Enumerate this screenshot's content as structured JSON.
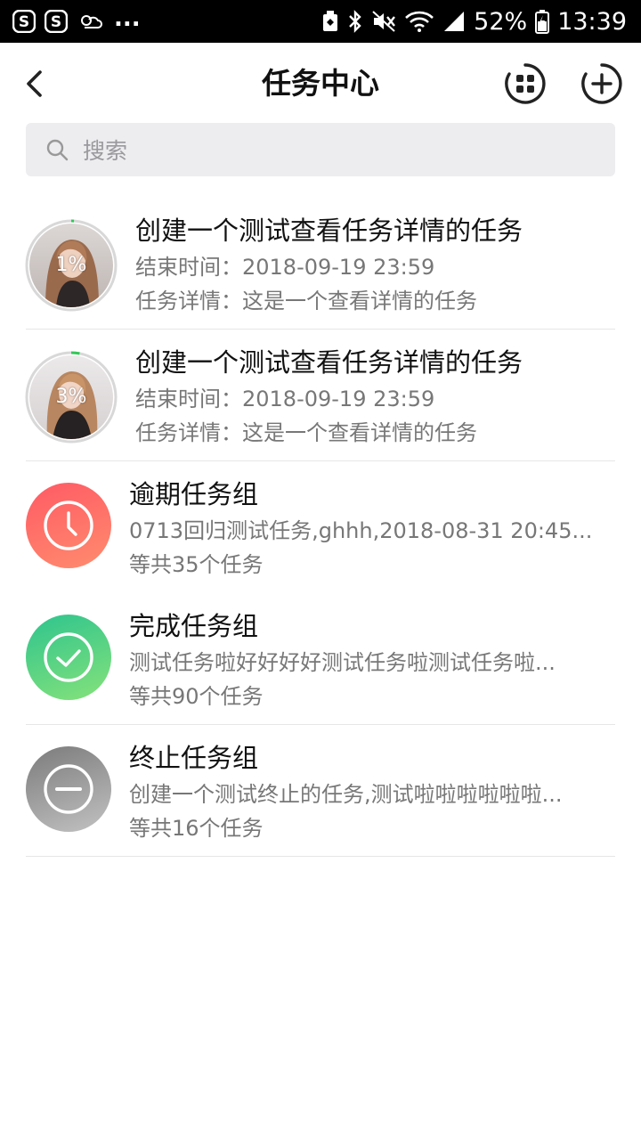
{
  "status_bar": {
    "left_icons": [
      "sogou-s-icon",
      "sogou-s-icon",
      "weather-icon"
    ],
    "overflow": "...",
    "right_icons": [
      "cleanup-icon",
      "bluetooth-icon",
      "mute-icon",
      "wifi-icon",
      "signal-icon"
    ],
    "battery": "52%",
    "time": "13:39"
  },
  "navbar": {
    "back_icon": "chevron-left-icon",
    "title": "任务中心",
    "grid_icon": "grid-circle-icon",
    "add_icon": "plus-circle-icon"
  },
  "search": {
    "placeholder": "搜索"
  },
  "tasks": [
    {
      "title": "创建一个测试查看任务详情的任务",
      "end_time": "结束时间：2018-09-19 23:59",
      "detail": "任务详情：这是一个查看详情的任务",
      "progress_label": "1%",
      "progress": 0.01
    },
    {
      "title": "创建一个测试查看任务详情的任务",
      "end_time": "结束时间：2018-09-19 23:59",
      "detail": "任务详情：这是一个查看详情的任务",
      "progress_label": "3%",
      "progress": 0.03
    }
  ],
  "groups": [
    {
      "title": "逾期任务组",
      "preview": "0713回归测试任务,ghhh,2018-08-31 20:45...",
      "count": "等共35个任务",
      "icon": "clock-icon",
      "color": "#ff6f69"
    },
    {
      "title": "完成任务组",
      "preview": "测试任务啦好好好好测试任务啦测试任务啦...",
      "count": "等共90个任务",
      "icon": "check-icon",
      "color": "#4fd487"
    },
    {
      "title": "终止任务组",
      "preview": "创建一个测试终止的任务,测试啦啦啦啦啦啦...",
      "count": "等共16个任务",
      "icon": "minus-icon",
      "color": "#9a9a9a"
    }
  ],
  "colors": {
    "progress_ring": "#34c759",
    "divider": "#e6e6e6",
    "search_bg": "#ededf0"
  }
}
